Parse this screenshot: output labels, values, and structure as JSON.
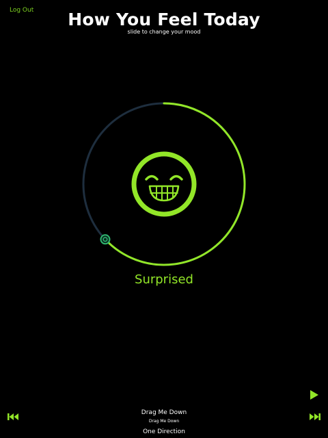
{
  "header": {
    "logout_label": "Log Out",
    "title": "How You Feel Today",
    "subtitle": "slide to change your mood"
  },
  "mood": {
    "label": "Surprised",
    "level": 0.63,
    "face_icon": "grinning-face-icon",
    "accent_color": "#92e628",
    "track_color": "#1e2e3e"
  },
  "player": {
    "play_icon": "play-icon",
    "prev_icon": "skip-back-icon",
    "next_icon": "skip-forward-icon",
    "track_title": "Drag Me Down",
    "track_album": "Drag Me Down",
    "track_artist": "One Direction"
  }
}
